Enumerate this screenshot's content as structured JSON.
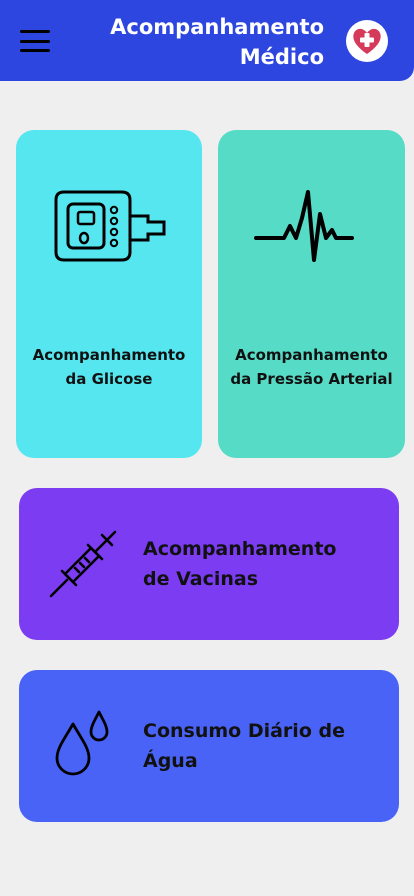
{
  "header": {
    "title_line1": "Acompanhamento",
    "title_line2": "Médico",
    "menu_icon": "hamburger-menu-icon",
    "logo_icon": "heart-medical-cross-icon",
    "background": "#2e46e0"
  },
  "cards": {
    "glucose": {
      "label_line1": "Acompanhamento",
      "label_line2": "da Glicose",
      "icon": "glucometer-icon",
      "color": "#55e6ef"
    },
    "pressure": {
      "label_line1": "Acompanhamento",
      "label_line2": "da Pressão Arterial",
      "icon": "heartbeat-pulse-icon",
      "color": "#56dbc6"
    },
    "vaccine": {
      "label_line1": "Acompanhamento",
      "label_line2": "de Vacinas",
      "icon": "syringe-icon",
      "color": "#7b3cf2"
    },
    "water": {
      "label_line1": "Consumo Diário de",
      "label_line2": "Água",
      "icon": "water-drops-icon",
      "color": "#4a63f7"
    }
  }
}
